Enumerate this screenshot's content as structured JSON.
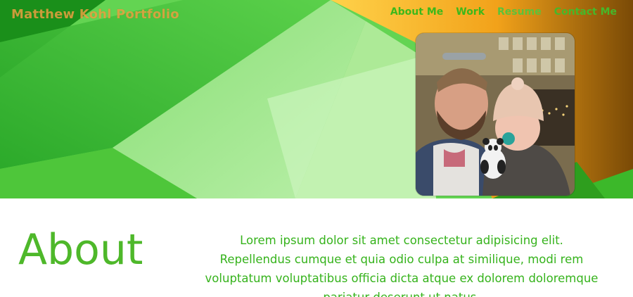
{
  "header": {
    "brand": "Matthew Kohl Portfolio",
    "nav": [
      {
        "label": "About Me"
      },
      {
        "label": "Work"
      },
      {
        "label": "Resume"
      },
      {
        "label": "Contact Me"
      }
    ]
  },
  "hero": {
    "photo_alt": "Profile photo of a man holding a baby"
  },
  "about": {
    "title": "About",
    "body": "Lorem ipsum dolor sit amet consectetur adipisicing elit. Repellendus cumque et quia odio culpa at similique, modi rem voluptatum voluptatibus officia dicta atque ex dolorem doloremque pariatur deserunt ut natus."
  },
  "colors": {
    "brand": "#e8a040",
    "nav": "#3db81a",
    "accent": "#4eb82a"
  }
}
